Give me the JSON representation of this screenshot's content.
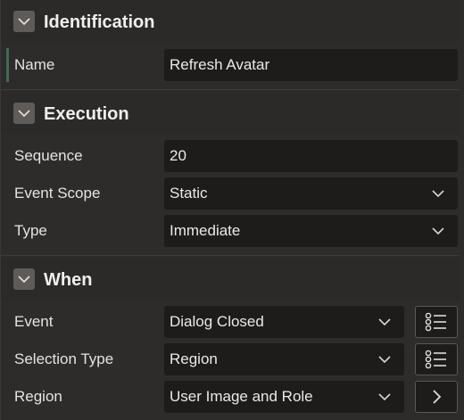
{
  "sections": {
    "identification": {
      "title": "Identification",
      "fields": {
        "name": {
          "label": "Name",
          "value": "Refresh Avatar"
        }
      }
    },
    "execution": {
      "title": "Execution",
      "fields": {
        "sequence": {
          "label": "Sequence",
          "value": "20"
        },
        "event_scope": {
          "label": "Event Scope",
          "value": "Static"
        },
        "type": {
          "label": "Type",
          "value": "Immediate"
        }
      }
    },
    "when": {
      "title": "When",
      "fields": {
        "event": {
          "label": "Event",
          "value": "Dialog Closed"
        },
        "selection_type": {
          "label": "Selection Type",
          "value": "Region"
        },
        "region": {
          "label": "Region",
          "value": "User Image and Role"
        }
      }
    }
  },
  "icons": {
    "collapse": "chevron-down-icon",
    "dropdown": "chevron-down-icon",
    "list": "list-icon",
    "go": "chevron-right-icon"
  },
  "colors": {
    "background": "#2e2c2b",
    "field_bg": "#1d1c1b",
    "toggle_bg": "#5e5b58",
    "active_marker": "#3f6b55"
  }
}
